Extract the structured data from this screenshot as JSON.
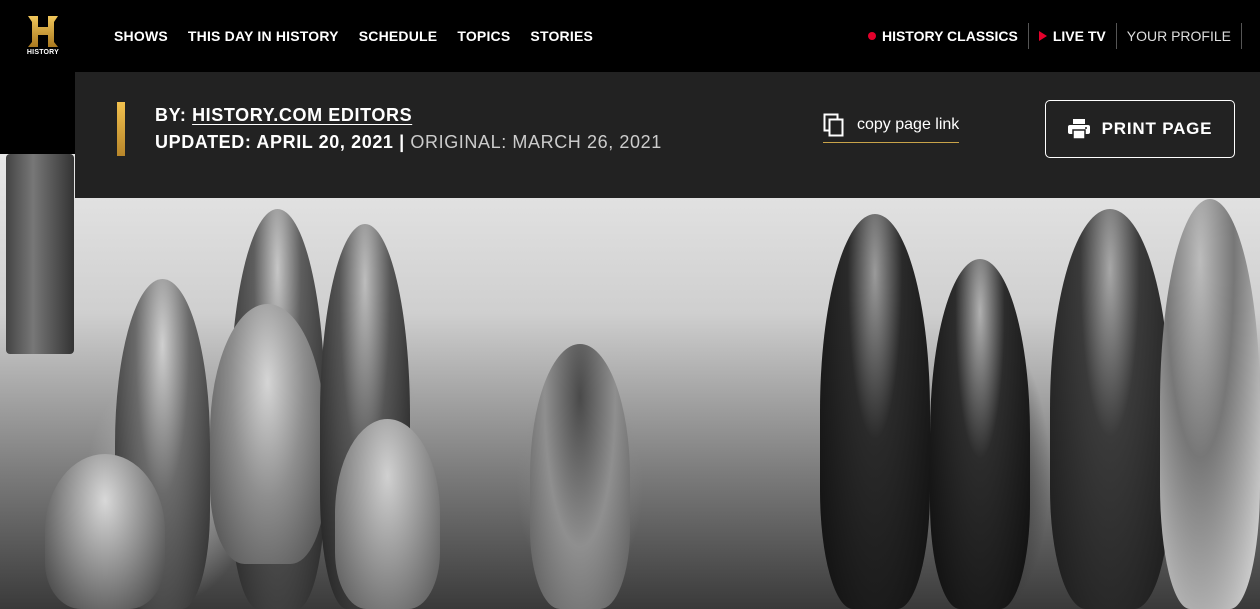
{
  "nav": {
    "logo_word": "HISTORY",
    "links": [
      "SHOWS",
      "THIS DAY IN HISTORY",
      "SCHEDULE",
      "TOPICS",
      "STORIES"
    ],
    "right": {
      "classics": "HISTORY CLASSICS",
      "live": "LIVE TV",
      "profile": "YOUR PROFILE"
    }
  },
  "byline": {
    "by_prefix": "BY: ",
    "author": "HISTORY.COM EDITORS",
    "updated_label": "UPDATED: APRIL 20, 2021",
    "separator": " | ",
    "original_label": "ORIGINAL: MARCH 26, 2021"
  },
  "actions": {
    "copy_link": "copy page link",
    "print": "PRINT PAGE"
  },
  "colors": {
    "accent_gold": "#c9a349",
    "live_red": "#e4002b",
    "bar_bg": "#222222"
  },
  "icons": [
    "history-logo",
    "red-dot-icon",
    "play-icon",
    "copy-icon",
    "printer-icon"
  ]
}
